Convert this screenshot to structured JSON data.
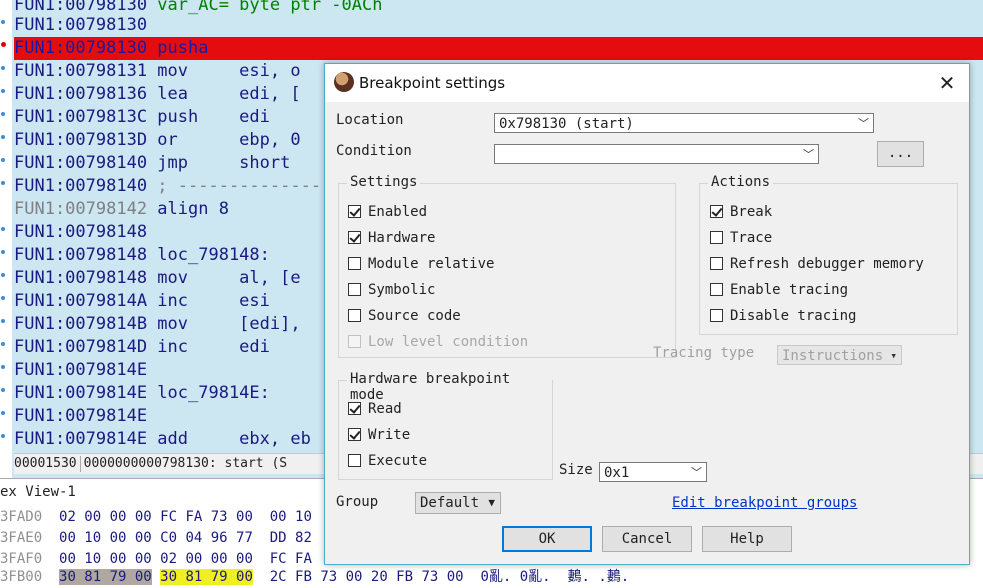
{
  "ida": {
    "lines": [
      {
        "addr": "FUN1:00798130",
        "text": " var_AC= byte ptr -0ACh"
      },
      {
        "addr": "FUN1:00798130",
        "text": ""
      },
      {
        "addr": "FUN1:00798130",
        "text": " pusha"
      },
      {
        "addr": "FUN1:00798131",
        "text": " mov     esi, o"
      },
      {
        "addr": "FUN1:00798136",
        "text": " lea     edi, ["
      },
      {
        "addr": "FUN1:0079813C",
        "text": " push    edi"
      },
      {
        "addr": "FUN1:0079813D",
        "text": " or      ebp, 0"
      },
      {
        "addr": "FUN1:00798140",
        "text": " jmp     short"
      },
      {
        "addr": "FUN1:00798140",
        "text": " ; ------------------------------------------------------------"
      },
      {
        "addr": "FUN1:00798142",
        "text": " align 8"
      },
      {
        "addr": "FUN1:00798148",
        "text": ""
      },
      {
        "addr": "FUN1:00798148",
        "text": " loc_798148:"
      },
      {
        "addr": "FUN1:00798148",
        "text": " mov     al, [e"
      },
      {
        "addr": "FUN1:0079814A",
        "text": " inc     esi"
      },
      {
        "addr": "FUN1:0079814B",
        "text": " mov     [edi],"
      },
      {
        "addr": "FUN1:0079814D",
        "text": " inc     edi"
      },
      {
        "addr": "FUN1:0079814E",
        "text": ""
      },
      {
        "addr": "FUN1:0079814E",
        "text": " loc_79814E:"
      },
      {
        "addr": "FUN1:0079814E",
        "text": ""
      },
      {
        "addr": "FUN1:0079814E",
        "text": " add     ebx, eb"
      }
    ],
    "status_offset": "00001530",
    "status_location": "0000000000798130: start (S"
  },
  "hex": {
    "title": "ex View-1",
    "rows": [
      {
        "addr": "3FAD0",
        "bytes": "  02 00 00 00 FC FA 73 00  00 10"
      },
      {
        "addr": "3FAE0",
        "bytes": "  00 10 00 00 C0 04 96 77  DD 82"
      },
      {
        "addr": "3FAF0",
        "bytes": "  00 10 00 00 02 00 00 00  FC FA"
      },
      {
        "addr": "3FB00",
        "bytes_a": "  ",
        "bytes_hl1": "30 81 79 00",
        "bytes_b": " ",
        "bytes_hl2": "30 81 79 00",
        "bytes_c": "  2C FB 73 00 20 FB 73 00  0亂. 0亂.  鶈. .鶈."
      }
    ]
  },
  "dialog": {
    "title": "Breakpoint settings",
    "close": "✕",
    "location_label": "Location",
    "location_value": "0x798130 (start)",
    "condition_label": "Condition",
    "condition_value": "",
    "ellipsis_button": "...",
    "settings_group": "Settings",
    "settings": [
      {
        "label": "Enabled",
        "checked": true,
        "disabled": false
      },
      {
        "label": "Hardware",
        "checked": true,
        "disabled": false
      },
      {
        "label": "Module relative",
        "checked": false,
        "disabled": false
      },
      {
        "label": "Symbolic",
        "checked": false,
        "disabled": false
      },
      {
        "label": "Source code",
        "checked": false,
        "disabled": false
      },
      {
        "label": "Low level condition",
        "checked": false,
        "disabled": true
      }
    ],
    "actions_group": "Actions",
    "actions": [
      {
        "label": "Break",
        "checked": true
      },
      {
        "label": "Trace",
        "checked": false
      },
      {
        "label": "Refresh debugger memory",
        "checked": false
      },
      {
        "label": "Enable tracing",
        "checked": false
      },
      {
        "label": "Disable tracing",
        "checked": false
      }
    ],
    "tracing_type_label": "Tracing type",
    "tracing_type_value": "Instructions",
    "hw_group": "Hardware breakpoint mode",
    "hw_modes": [
      {
        "label": "Read",
        "checked": true
      },
      {
        "label": "Write",
        "checked": true
      },
      {
        "label": "Execute",
        "checked": false
      }
    ],
    "size_label": "Size",
    "size_value": "0x1",
    "group_label": "Group",
    "group_value": "Default",
    "edit_groups_link": "Edit breakpoint groups",
    "ok": "OK",
    "cancel": "Cancel",
    "help": "Help"
  }
}
